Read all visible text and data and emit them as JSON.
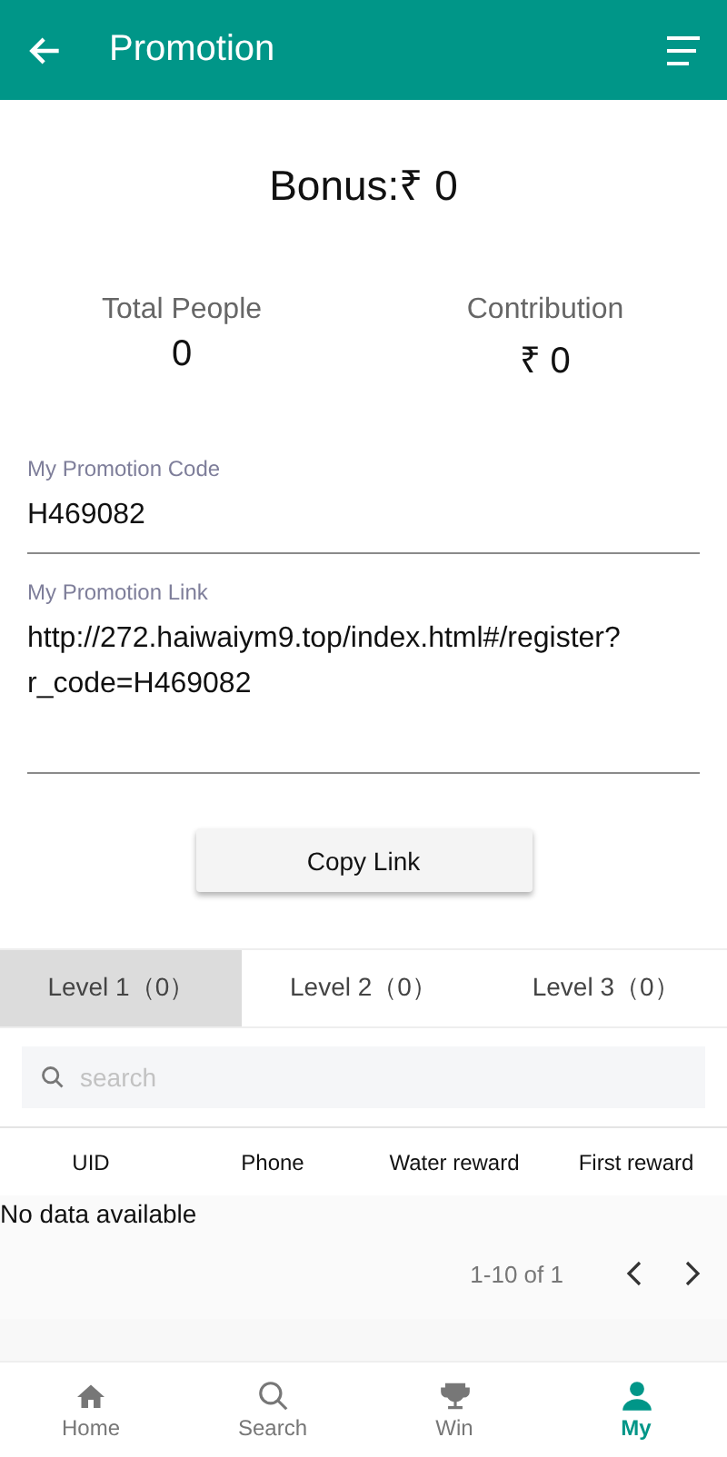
{
  "header": {
    "title": "Promotion"
  },
  "bonus": "Bonus:₹ 0",
  "stats": [
    {
      "label": "Total People",
      "value": "0"
    },
    {
      "label": "Contribution",
      "value": "₹ 0"
    }
  ],
  "fields": [
    {
      "label": "My Promotion Code",
      "value": "H469082"
    },
    {
      "label": "My Promotion Link",
      "value": "http://272.haiwaiym9.top/index.html#/register?r_code=H469082"
    }
  ],
  "copy_button": "Copy Link",
  "tabs": [
    {
      "label": "Level 1（0）",
      "selected": true
    },
    {
      "label": "Level 2（0）",
      "selected": false
    },
    {
      "label": "Level 3（0）",
      "selected": false
    }
  ],
  "search": {
    "placeholder": "search"
  },
  "table": {
    "columns": [
      "UID",
      "Phone",
      "Water reward",
      "First reward"
    ],
    "empty": "No data available",
    "pagination": "1-10 of 1"
  },
  "bottom_nav": [
    {
      "label": "Home",
      "kind": "home",
      "selected": false
    },
    {
      "label": "Search",
      "kind": "search",
      "selected": false
    },
    {
      "label": "Win",
      "kind": "trophy",
      "selected": false
    },
    {
      "label": "My",
      "kind": "user",
      "selected": true
    }
  ]
}
